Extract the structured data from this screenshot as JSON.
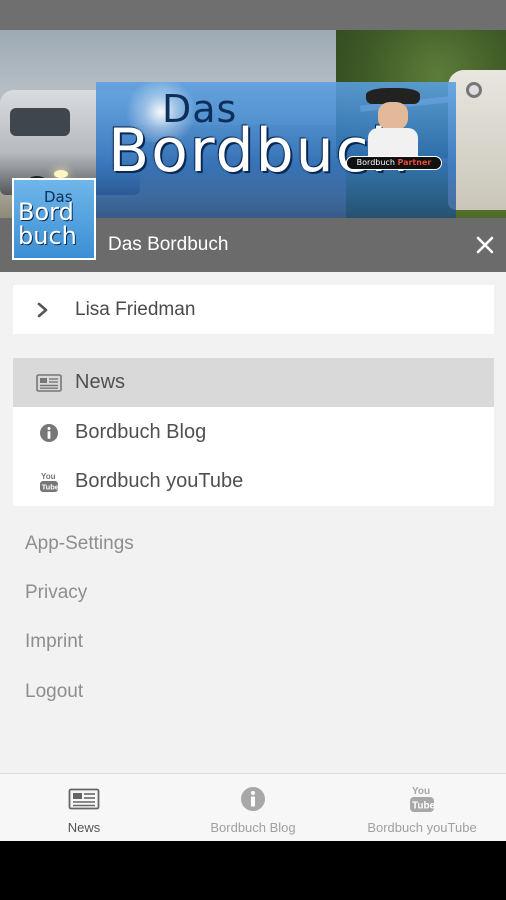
{
  "header": {
    "app_title": "Das Bordbuch",
    "banner_logo_small": "Das",
    "banner_logo_large": "Bordbuch",
    "banner_badge_prefix": "Bordbuch",
    "banner_badge_suffix": "Partner",
    "app_icon_line1": "Das",
    "app_icon_line2": "Bord",
    "app_icon_line3": "buch",
    "close_icon": "close-icon"
  },
  "user": {
    "name": "Lisa Friedman",
    "icon": "chevron-right-icon"
  },
  "menu": {
    "items": [
      {
        "label": "News",
        "icon": "newspaper-icon",
        "active": true
      },
      {
        "label": "Bordbuch Blog",
        "icon": "info-icon",
        "active": false
      },
      {
        "label": "Bordbuch youTube",
        "icon": "youtube-icon",
        "active": false
      }
    ]
  },
  "links": {
    "settings": "App-Settings",
    "privacy": "Privacy",
    "imprint": "Imprint",
    "logout": "Logout"
  },
  "tabs": [
    {
      "label": "News",
      "icon": "newspaper-icon",
      "active": true
    },
    {
      "label": "Bordbuch Blog",
      "icon": "info-icon",
      "active": false
    },
    {
      "label": "Bordbuch youTube",
      "icon": "youtube-icon",
      "active": false
    }
  ],
  "colors": {
    "header_bg": "#6b6b6b",
    "drawer_bg": "#f2f2f2",
    "active_item_bg": "#d9d9d9",
    "text_primary": "#505050",
    "text_muted": "#8e8e8e"
  }
}
